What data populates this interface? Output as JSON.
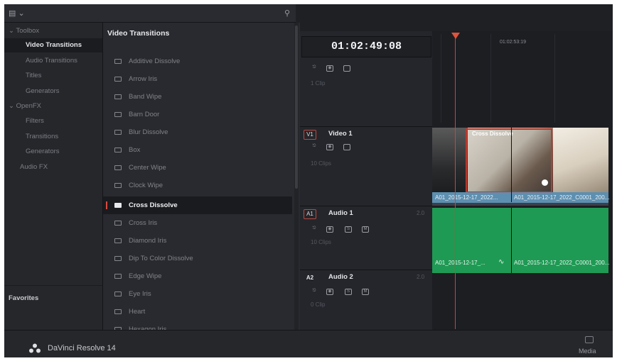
{
  "toolbar": {
    "panel_icon": "panel-toggle-icon",
    "search_icon": "search-icon"
  },
  "sidebar": {
    "toolbox": "Toolbox",
    "items": [
      {
        "label": "Video Transitions",
        "selected": true
      },
      {
        "label": "Audio Transitions"
      },
      {
        "label": "Titles"
      },
      {
        "label": "Generators"
      }
    ],
    "openfx": "OpenFX",
    "openfx_items": [
      "Filters",
      "Transitions",
      "Generators"
    ],
    "audio_fx": "Audio FX",
    "favorites": "Favorites"
  },
  "list": {
    "title": "Video Transitions",
    "items": [
      "Additive Dissolve",
      "Arrow Iris",
      "Band Wipe",
      "Barn Door",
      "Blur Dissolve",
      "Box",
      "Center Wipe",
      "Clock Wipe",
      "Cross Dissolve",
      "Cross Iris",
      "Diamond Iris",
      "Dip To Color Dissolve",
      "Edge Wipe",
      "Eye Iris",
      "Heart",
      "Hexagon Iris"
    ],
    "selected_index": 8
  },
  "timeline": {
    "timecode": "01:02:49:08",
    "ruler_timecode": "01:02:53:19",
    "tracks": {
      "v_top_clips": "1 Clip",
      "v1_tag": "V1",
      "v1_name": "Video 1",
      "v1_clips": "10 Clips",
      "a1_tag": "A1",
      "a1_name": "Audio 1",
      "a1_ch": "2.0",
      "a1_clips": "10 Clips",
      "a2_tag": "A2",
      "a2_name": "Audio 2",
      "a2_ch": "2.0",
      "a2_clips": "0 Clip"
    },
    "transition_label": "Cross Dissolve",
    "video_clip1": "A01_2015-12-17_2022...",
    "video_clip2": "A01_2015-12-17_2022_C0001_200...",
    "audio_clip1": "A01_2015-12-17_...",
    "audio_clip2": "A01_2015-12-17_2022_C0001_200..."
  },
  "app": {
    "name": "DaVinci Resolve 14"
  },
  "page_nav": {
    "media": "Media"
  },
  "colors": {
    "accent": "#d9402f",
    "video_clip": "#5d8fb0",
    "audio_clip": "#1f9a54"
  }
}
